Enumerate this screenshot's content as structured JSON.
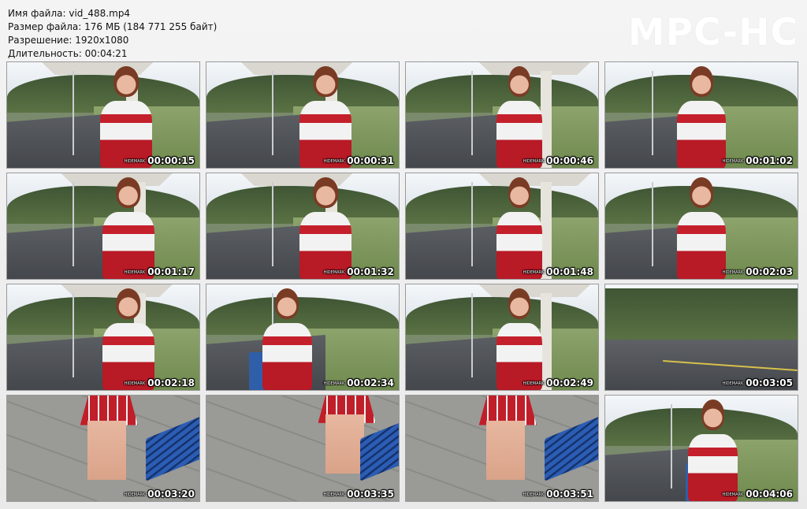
{
  "info": {
    "filename": "Имя файла: vid_488.mp4",
    "filesize": "Размер файла: 176 МБ (184 771 255 байт)",
    "resolution": "Разрешение: 1920x1080",
    "duration": "Длительность: 00:04:21"
  },
  "logo": "MPC-HC",
  "thumbnails": [
    {
      "time": "00:00:15",
      "scene": "stop-wide"
    },
    {
      "time": "00:00:31",
      "scene": "stop-wide"
    },
    {
      "time": "00:00:46",
      "scene": "stop-right"
    },
    {
      "time": "00:01:02",
      "scene": "road-side"
    },
    {
      "time": "00:01:17",
      "scene": "stop-left"
    },
    {
      "time": "00:01:32",
      "scene": "roof-close"
    },
    {
      "time": "00:01:48",
      "scene": "stop-right"
    },
    {
      "time": "00:02:03",
      "scene": "road-side"
    },
    {
      "time": "00:02:18",
      "scene": "stop-left"
    },
    {
      "time": "00:02:34",
      "scene": "grass-bin"
    },
    {
      "time": "00:02:49",
      "scene": "stop-right"
    },
    {
      "time": "00:03:05",
      "scene": "road-only"
    },
    {
      "time": "00:03:20",
      "scene": "pavement"
    },
    {
      "time": "00:03:35",
      "scene": "pavement"
    },
    {
      "time": "00:03:51",
      "scene": "pavement"
    },
    {
      "time": "00:04:06",
      "scene": "grass-bin"
    }
  ],
  "watermark_small": "HIDEMARK",
  "colors": {
    "background": "#efefef",
    "logo": "#ffffff",
    "uniform_red": "#c01f2a"
  }
}
